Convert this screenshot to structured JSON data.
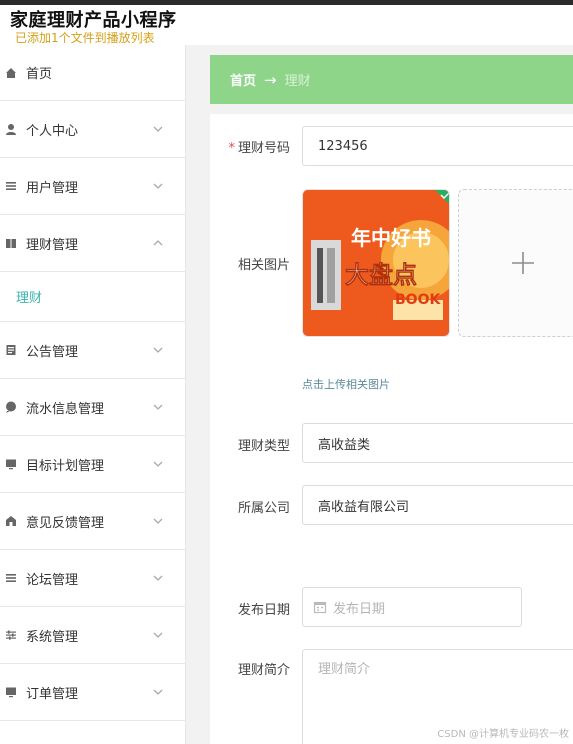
{
  "app": {
    "title": "家庭理财产品小程序",
    "subtitle": "已添加1个文件到播放列表"
  },
  "sidebar": {
    "home": "首页",
    "items": [
      {
        "label": "个人中心",
        "icon": "user-icon",
        "expanded": false
      },
      {
        "label": "用户管理",
        "icon": "list-icon",
        "expanded": false
      },
      {
        "label": "理财管理",
        "icon": "book-icon",
        "expanded": true,
        "sub": "理财"
      },
      {
        "label": "公告管理",
        "icon": "notice-icon",
        "expanded": false
      },
      {
        "label": "流水信息管理",
        "icon": "chat-icon",
        "expanded": false
      },
      {
        "label": "目标计划管理",
        "icon": "monitor-icon",
        "expanded": false
      },
      {
        "label": "意见反馈管理",
        "icon": "feedback-icon",
        "expanded": false
      },
      {
        "label": "论坛管理",
        "icon": "list-icon",
        "expanded": false
      },
      {
        "label": "系统管理",
        "icon": "settings-icon",
        "expanded": false
      },
      {
        "label": "订单管理",
        "icon": "monitor-icon",
        "expanded": false
      }
    ]
  },
  "breadcrumb": {
    "home": "首页",
    "arrow": "→",
    "current": "理财"
  },
  "form": {
    "code_label": "理财号码",
    "code_value": "123456",
    "image_label": "相关图片",
    "image_text_1": "年中好书",
    "image_text_2": "大盘点",
    "image_text_3": "BOOK",
    "upload_tip": "点击上传相关图片",
    "type_label": "理财类型",
    "type_value": "高收益类",
    "company_label": "所属公司",
    "company_value": "高收益有限公司",
    "date_label": "发布日期",
    "date_placeholder": "发布日期",
    "intro_label": "理财简介",
    "intro_placeholder": "理财简介"
  },
  "watermark": "CSDN @计算机专业码农一枚",
  "colors": {
    "accent": "#3bb4ae",
    "breadcrumb_bg": "#8ed58a",
    "required": "#e04e4e",
    "subtitle": "#d4a017"
  }
}
